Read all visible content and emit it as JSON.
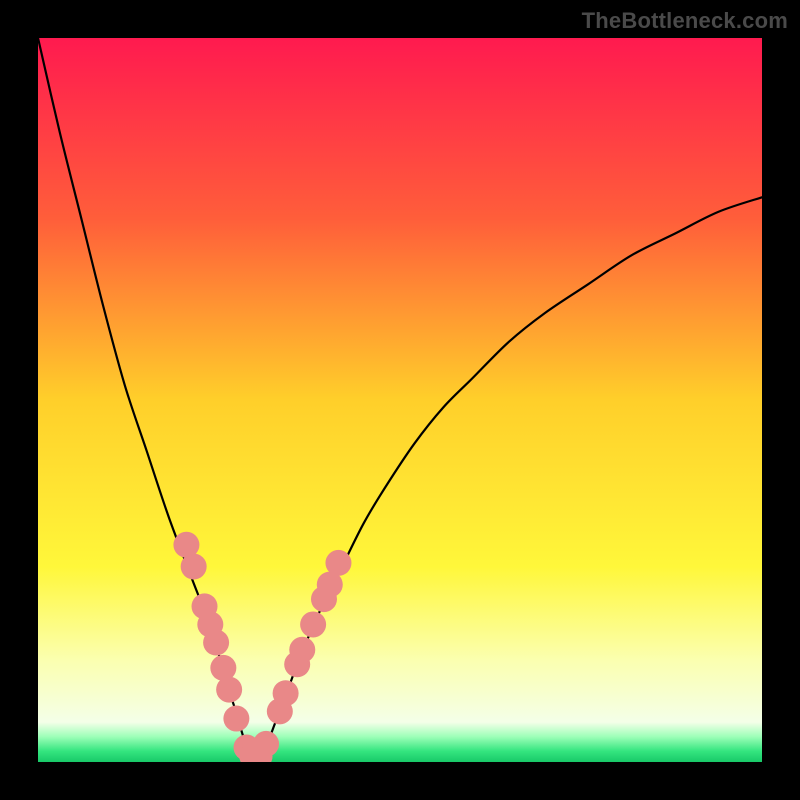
{
  "watermark": "TheBottleneck.com",
  "chart_data": {
    "type": "line",
    "title": "",
    "xlabel": "",
    "ylabel": "",
    "xlim": [
      0,
      100
    ],
    "ylim": [
      0,
      100
    ],
    "x_min_at": 30,
    "background_gradient": {
      "stops": [
        {
          "offset": 0.0,
          "color": "#ff1a4f"
        },
        {
          "offset": 0.25,
          "color": "#ff5e3a"
        },
        {
          "offset": 0.5,
          "color": "#ffcf2a"
        },
        {
          "offset": 0.73,
          "color": "#fff73a"
        },
        {
          "offset": 0.86,
          "color": "#fbffb0"
        },
        {
          "offset": 0.945,
          "color": "#f4ffe8"
        },
        {
          "offset": 0.965,
          "color": "#9dffb8"
        },
        {
          "offset": 0.985,
          "color": "#34e57f"
        },
        {
          "offset": 1.0,
          "color": "#18c968"
        }
      ]
    },
    "curve": {
      "x": [
        0,
        3,
        6,
        9,
        12,
        15,
        18,
        21,
        24,
        27,
        30,
        33,
        36,
        39,
        42,
        45,
        48,
        52,
        56,
        60,
        65,
        70,
        76,
        82,
        88,
        94,
        100
      ],
      "y": [
        100,
        87,
        75,
        63,
        52,
        43,
        34,
        26,
        18,
        8,
        0,
        6,
        14,
        21,
        27,
        33,
        38,
        44,
        49,
        53,
        58,
        62,
        66,
        70,
        73,
        76,
        78
      ]
    },
    "markers": {
      "color": "#e98888",
      "radius": 13,
      "left": [
        {
          "x": 20.5,
          "y": 30.0
        },
        {
          "x": 21.5,
          "y": 27.0
        },
        {
          "x": 23.0,
          "y": 21.5
        },
        {
          "x": 23.8,
          "y": 19.0
        },
        {
          "x": 24.6,
          "y": 16.5
        },
        {
          "x": 25.6,
          "y": 13.0
        },
        {
          "x": 26.4,
          "y": 10.0
        },
        {
          "x": 27.4,
          "y": 6.0
        },
        {
          "x": 28.8,
          "y": 2.0
        },
        {
          "x": 29.6,
          "y": 0.8
        }
      ],
      "right": [
        {
          "x": 30.6,
          "y": 0.8
        },
        {
          "x": 31.5,
          "y": 2.5
        },
        {
          "x": 33.4,
          "y": 7.0
        },
        {
          "x": 34.2,
          "y": 9.5
        },
        {
          "x": 35.8,
          "y": 13.5
        },
        {
          "x": 36.5,
          "y": 15.5
        },
        {
          "x": 38.0,
          "y": 19.0
        },
        {
          "x": 39.5,
          "y": 22.5
        },
        {
          "x": 40.3,
          "y": 24.5
        },
        {
          "x": 41.5,
          "y": 27.5
        }
      ]
    }
  }
}
